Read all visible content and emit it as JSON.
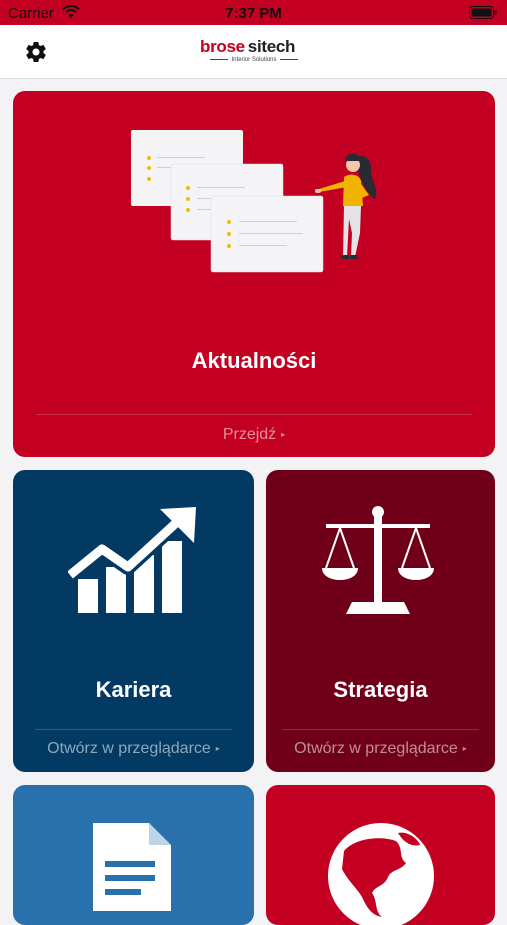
{
  "status_bar": {
    "carrier": "Carrier",
    "time": "7:37 PM"
  },
  "header": {
    "logo": {
      "brand": "brose",
      "name": "sitech",
      "tagline": "Interior Solutions"
    },
    "settings_icon": "gear-icon"
  },
  "tiles": {
    "news": {
      "title": "Aktualności",
      "link": "Przejdź",
      "arrow": "▸",
      "color": "#c30021",
      "icon": "news-illustration"
    },
    "career": {
      "title": "Kariera",
      "link": "Otwórz w przeglądarce",
      "arrow": "▸",
      "color": "#033a63",
      "icon": "growth-chart-icon"
    },
    "strategy": {
      "title": "Strategia",
      "link": "Otwórz w przeglądarce",
      "arrow": "▸",
      "color": "#70001a",
      "icon": "scales-icon"
    },
    "documents": {
      "color": "#2871ad",
      "icon": "document-icon"
    },
    "world": {
      "color": "#c30021",
      "icon": "globe-icon"
    }
  }
}
